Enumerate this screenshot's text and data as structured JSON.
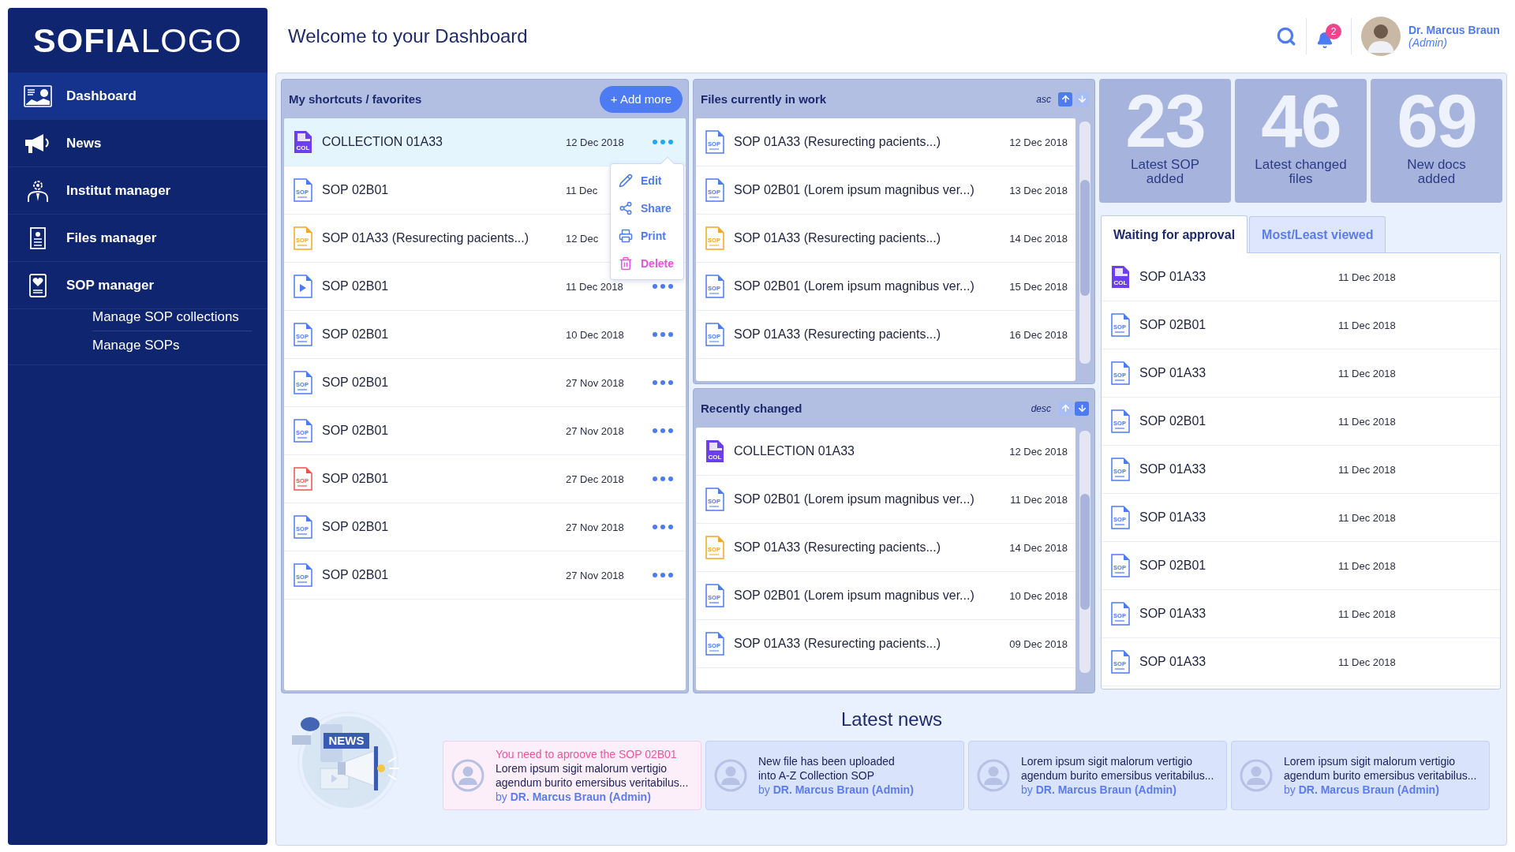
{
  "sidebar": {
    "logo": "**SOFIA**LOGO",
    "items": [
      {
        "label": "Dashboard",
        "selected": true
      },
      {
        "label": "News",
        "selected": false
      },
      {
        "label": "Institut manager",
        "selected": false
      },
      {
        "label": "Files manager",
        "selected": false
      },
      {
        "label": "SOP manager",
        "selected": false,
        "children": [
          {
            "label": "Manage SOP collections"
          },
          {
            "label": "Manage SOPs"
          }
        ]
      }
    ]
  },
  "header": {
    "title": "Welcome to your Dashboard",
    "notification_count": "2",
    "user_name": "Dr. Marcus Braun",
    "user_role": "(Admin)"
  },
  "shortcuts": {
    "title": "My shortcuts / favorites",
    "add_button": "+ Add more",
    "rows": [
      {
        "kind": "collection",
        "tag": "COL",
        "color": "#6b3ff0",
        "name": "COLLECTION 01A33",
        "date": "12 Dec 2018",
        "selected": true
      },
      {
        "kind": "doc",
        "tag": "SOP",
        "color": "#4d7bf3",
        "name": "SOP 02B01",
        "date": "11 Dec",
        "selected": false,
        "menu_button": false
      },
      {
        "kind": "doc",
        "tag": "SOP",
        "color": "#f5a623",
        "name": "SOP 01A33 (Resurecting pacients...)",
        "date": "12 Dec",
        "selected": false,
        "menu_button": false
      },
      {
        "kind": "video",
        "color": "#4d7bf3",
        "name": "SOP 02B01",
        "date": "11 Dec 2018",
        "selected": false
      },
      {
        "kind": "doc",
        "tag": "SOP",
        "color": "#4d7bf3",
        "name": "SOP 02B01",
        "date": "10 Dec 2018",
        "selected": false
      },
      {
        "kind": "doc",
        "tag": "SOP",
        "color": "#4d7bf3",
        "name": "SOP 02B01",
        "date": "27 Nov 2018",
        "selected": false
      },
      {
        "kind": "doc",
        "tag": "SOP",
        "color": "#4d7bf3",
        "name": "SOP 02B01",
        "date": "27 Nov 2018",
        "selected": false
      },
      {
        "kind": "doc",
        "tag": "SOP",
        "color": "#f0524f",
        "name": "SOP 02B01",
        "date": "27 Dec 2018",
        "selected": false
      },
      {
        "kind": "doc",
        "tag": "SOP",
        "color": "#4d7bf3",
        "name": "SOP 02B01",
        "date": "27 Nov 2018",
        "selected": false
      },
      {
        "kind": "doc",
        "tag": "SOP",
        "color": "#4d7bf3",
        "name": "SOP 02B01",
        "date": "27 Nov 2018",
        "selected": false
      }
    ],
    "menu": [
      {
        "kind": "edit",
        "label": "Edit"
      },
      {
        "kind": "share",
        "label": "Share"
      },
      {
        "kind": "print",
        "label": "Print"
      },
      {
        "kind": "delete",
        "label": "Delete"
      }
    ]
  },
  "files_in_work": {
    "title": "Files currently in work",
    "sort": {
      "label": "asc",
      "ascending": true
    },
    "rows": [
      {
        "kind": "doc",
        "tag": "SOP",
        "color": "#4d7bf3",
        "name": "SOP 01A33 (Resurecting pacients...)",
        "date": "12 Dec 2018"
      },
      {
        "kind": "doc",
        "tag": "SOP",
        "color": "#4d7bf3",
        "name": "SOP 02B01 (Lorem ipsum magnibus ver...)",
        "date": "13 Dec 2018"
      },
      {
        "kind": "doc",
        "tag": "SOP",
        "color": "#f5a623",
        "name": "SOP 01A33 (Resurecting pacients...)",
        "date": "14 Dec 2018"
      },
      {
        "kind": "doc",
        "tag": "SOP",
        "color": "#4d7bf3",
        "name": "SOP 02B01 (Lorem ipsum magnibus ver...)",
        "date": "15 Dec 2018"
      },
      {
        "kind": "doc",
        "tag": "SOP",
        "color": "#4d7bf3",
        "name": "SOP 01A33 (Resurecting pacients...)",
        "date": "16 Dec 2018"
      }
    ]
  },
  "recently_changed": {
    "title": "Recently changed",
    "sort": {
      "label": "desc",
      "ascending": false
    },
    "rows": [
      {
        "kind": "collection",
        "tag": "COL",
        "color": "#6b3ff0",
        "name": "COLLECTION 01A33",
        "date": "12 Dec 2018"
      },
      {
        "kind": "doc",
        "tag": "SOP",
        "color": "#4d7bf3",
        "name": "SOP 02B01 (Lorem ipsum magnibus ver...)",
        "date": "11 Dec 2018"
      },
      {
        "kind": "doc",
        "tag": "SOP",
        "color": "#f5a623",
        "name": "SOP 01A33 (Resurecting pacients...)",
        "date": "14 Dec 2018"
      },
      {
        "kind": "doc",
        "tag": "SOP",
        "color": "#4d7bf3",
        "name": "SOP 02B01 (Lorem ipsum magnibus ver...)",
        "date": "10 Dec 2018"
      },
      {
        "kind": "doc",
        "tag": "SOP",
        "color": "#4d7bf3",
        "name": "SOP 01A33 (Resurecting pacients...)",
        "date": "09 Dec 2018"
      }
    ]
  },
  "stats": [
    {
      "value": "23",
      "label": "Latest SOP\nadded"
    },
    {
      "value": "46",
      "label": "Latest changed\nfiles"
    },
    {
      "value": "69",
      "label": "New docs\nadded"
    }
  ],
  "approval": {
    "tabs": [
      {
        "label": "Waiting for approval",
        "selected": true
      },
      {
        "label": "Most/Least viewed",
        "selected": false
      }
    ],
    "rows": [
      {
        "kind": "collection",
        "tag": "COL",
        "color": "#6b3ff0",
        "name": "SOP 01A33",
        "date": "11 Dec 2018"
      },
      {
        "kind": "doc",
        "tag": "SOP",
        "color": "#4d7bf3",
        "name": "SOP 02B01",
        "date": "11 Dec 2018"
      },
      {
        "kind": "doc",
        "tag": "SOP",
        "color": "#4d7bf3",
        "name": "SOP 01A33",
        "date": "11 Dec 2018"
      },
      {
        "kind": "doc",
        "tag": "SOP",
        "color": "#4d7bf3",
        "name": "SOP 02B01",
        "date": "11 Dec 2018"
      },
      {
        "kind": "doc",
        "tag": "SOP",
        "color": "#4d7bf3",
        "name": "SOP 01A33",
        "date": "11 Dec 2018"
      },
      {
        "kind": "doc",
        "tag": "SOP",
        "color": "#4d7bf3",
        "name": "SOP 01A33",
        "date": "11 Dec 2018"
      },
      {
        "kind": "doc",
        "tag": "SOP",
        "color": "#4d7bf3",
        "name": "SOP 02B01",
        "date": "11 Dec 2018"
      },
      {
        "kind": "doc",
        "tag": "SOP",
        "color": "#4d7bf3",
        "name": "SOP 01A33",
        "date": "11 Dec 2018"
      },
      {
        "kind": "doc",
        "tag": "SOP",
        "color": "#4d7bf3",
        "name": "SOP 01A33",
        "date": "11 Dec 2018"
      }
    ]
  },
  "news": {
    "title": "Latest news",
    "illustration_label": "NEWS",
    "cards": [
      {
        "kind": "alert",
        "headline": "You need to aproove the SOP 02B01",
        "body_lines": [
          "Lorem ipsum sigit malorum vertigio",
          "agendum burito emersibus veritabilus..."
        ],
        "author": "by **DR. Marcus Braun (Admin)**"
      },
      {
        "kind": "info",
        "body_lines": [
          "New file has been uploaded",
          "into A-Z Collection SOP"
        ],
        "author": "by **DR. Marcus Braun (Admin)**"
      },
      {
        "kind": "info",
        "body_lines": [
          "Lorem ipsum sigit malorum vertigio",
          "agendum burito emersibus veritabilus..."
        ],
        "author": "by **DR. Marcus Braun (Admin)**"
      },
      {
        "kind": "info",
        "body_lines": [
          "Lorem ipsum sigit malorum vertigio",
          "agendum burito emersibus veritabilus..."
        ],
        "author": "by **DR. Marcus Braun (Admin)**"
      }
    ]
  }
}
